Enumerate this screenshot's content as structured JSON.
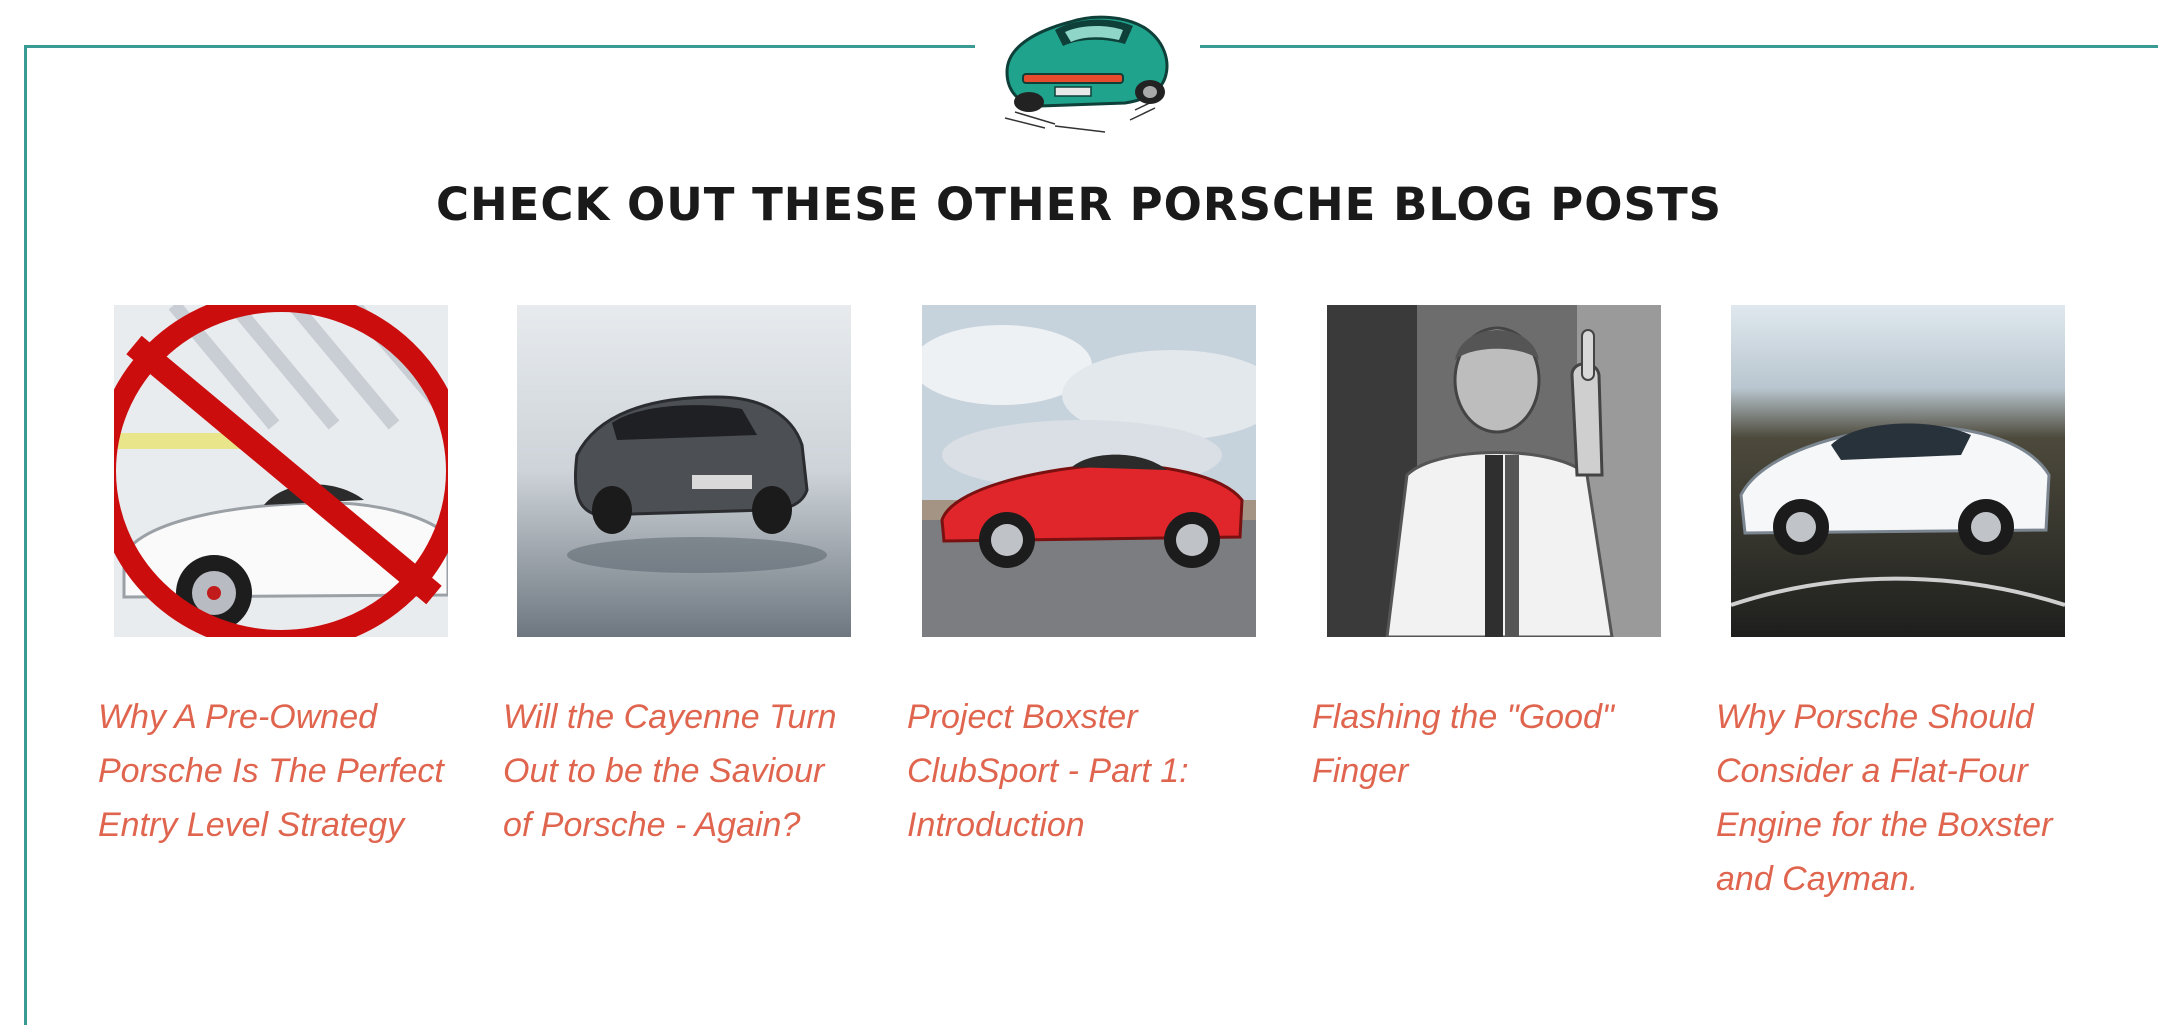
{
  "section": {
    "heading": "CHECK OUT THESE OTHER PORSCHE BLOG POSTS",
    "badge_icon": "porsche-911-car-icon",
    "frame_color": "#3a9b95",
    "link_color": "#e0654f"
  },
  "posts": [
    {
      "title": "Why A Pre-Owned Porsche Is The Perfect Entry Level Strategy",
      "image": "white-convertible-with-red-prohibition-sign"
    },
    {
      "title": "Will the Cayenne Turn Out to be the Saviour of Porsche - Again?",
      "image": "grey-cayenne-suv"
    },
    {
      "title": "Project Boxster ClubSport - Part 1: Introduction",
      "image": "red-boxster-side-view"
    },
    {
      "title": "Flashing the \"Good\" Finger",
      "image": "racer-in-white-suit-black-and-white-photo"
    },
    {
      "title": "Why Porsche Should Consider a Flat-Four Engine for the Boxster and Cayman.",
      "image": "white-cayman-on-road"
    }
  ]
}
